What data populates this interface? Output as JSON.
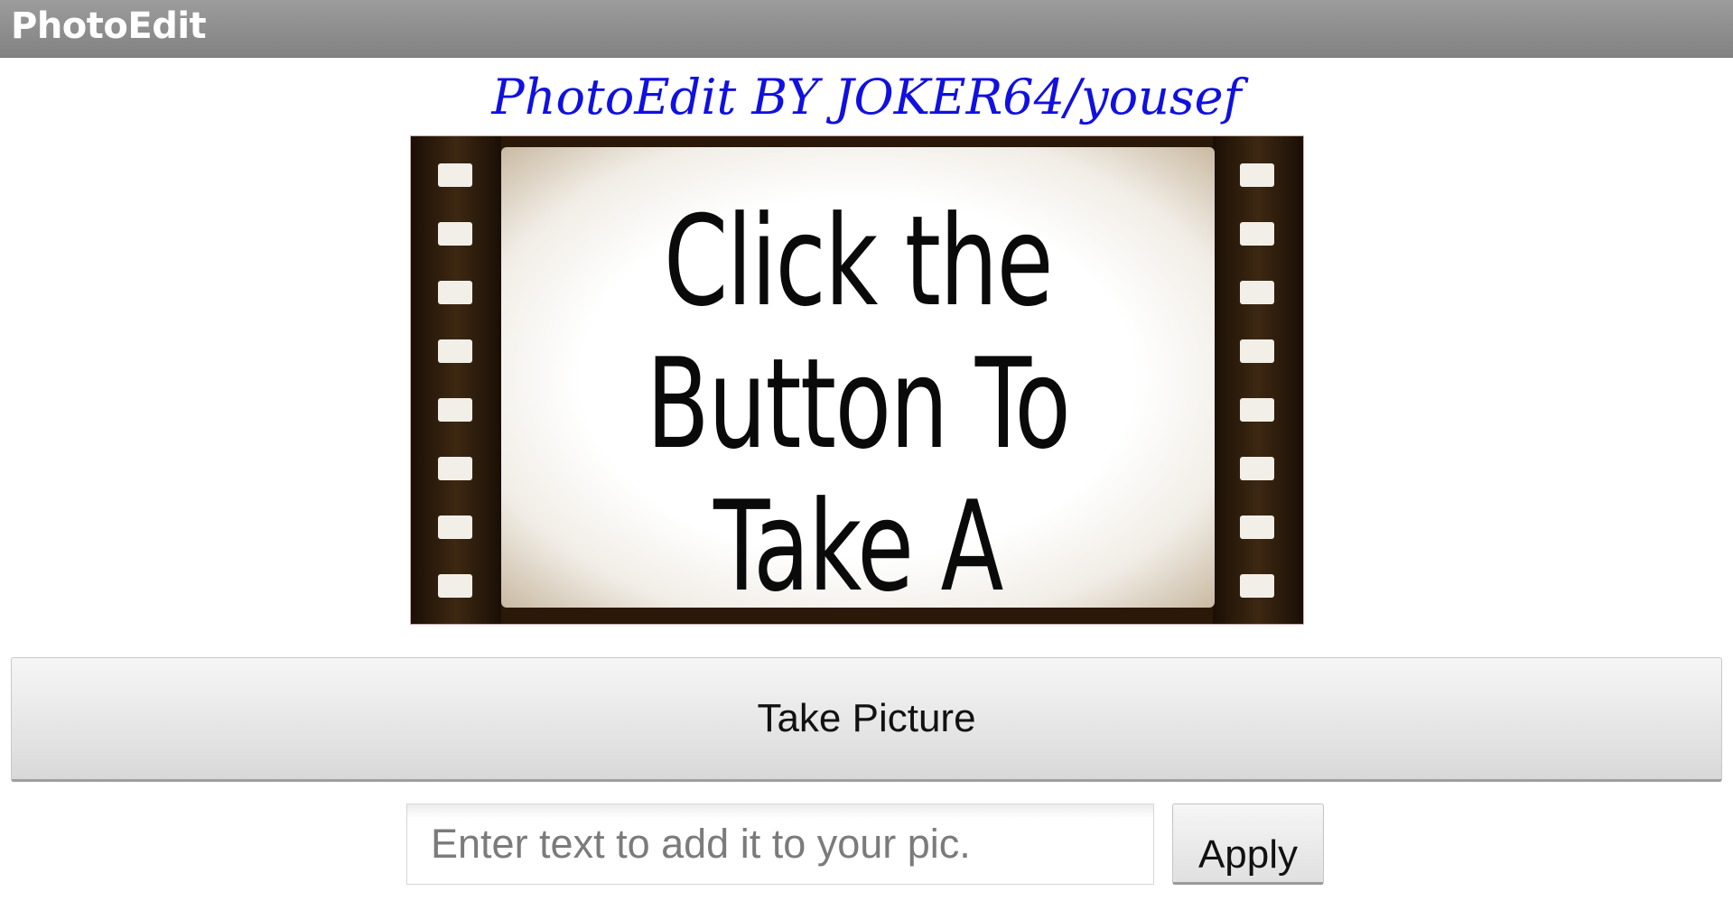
{
  "app": {
    "title": "PhotoEdit"
  },
  "header": {
    "credit": "PhotoEdit BY JOKER64/yousef"
  },
  "photo": {
    "placeholder_text_line1": "Click the",
    "placeholder_text_line2": "Button To",
    "placeholder_text_line3": "Take A Picture"
  },
  "actions": {
    "take_picture_label": "Take Picture",
    "apply_label": "Apply"
  },
  "caption_input": {
    "value": "",
    "placeholder": "Enter text to add it to your pic."
  },
  "colors": {
    "titlebar": "#8c8c8c",
    "heading": "#1010e0"
  }
}
